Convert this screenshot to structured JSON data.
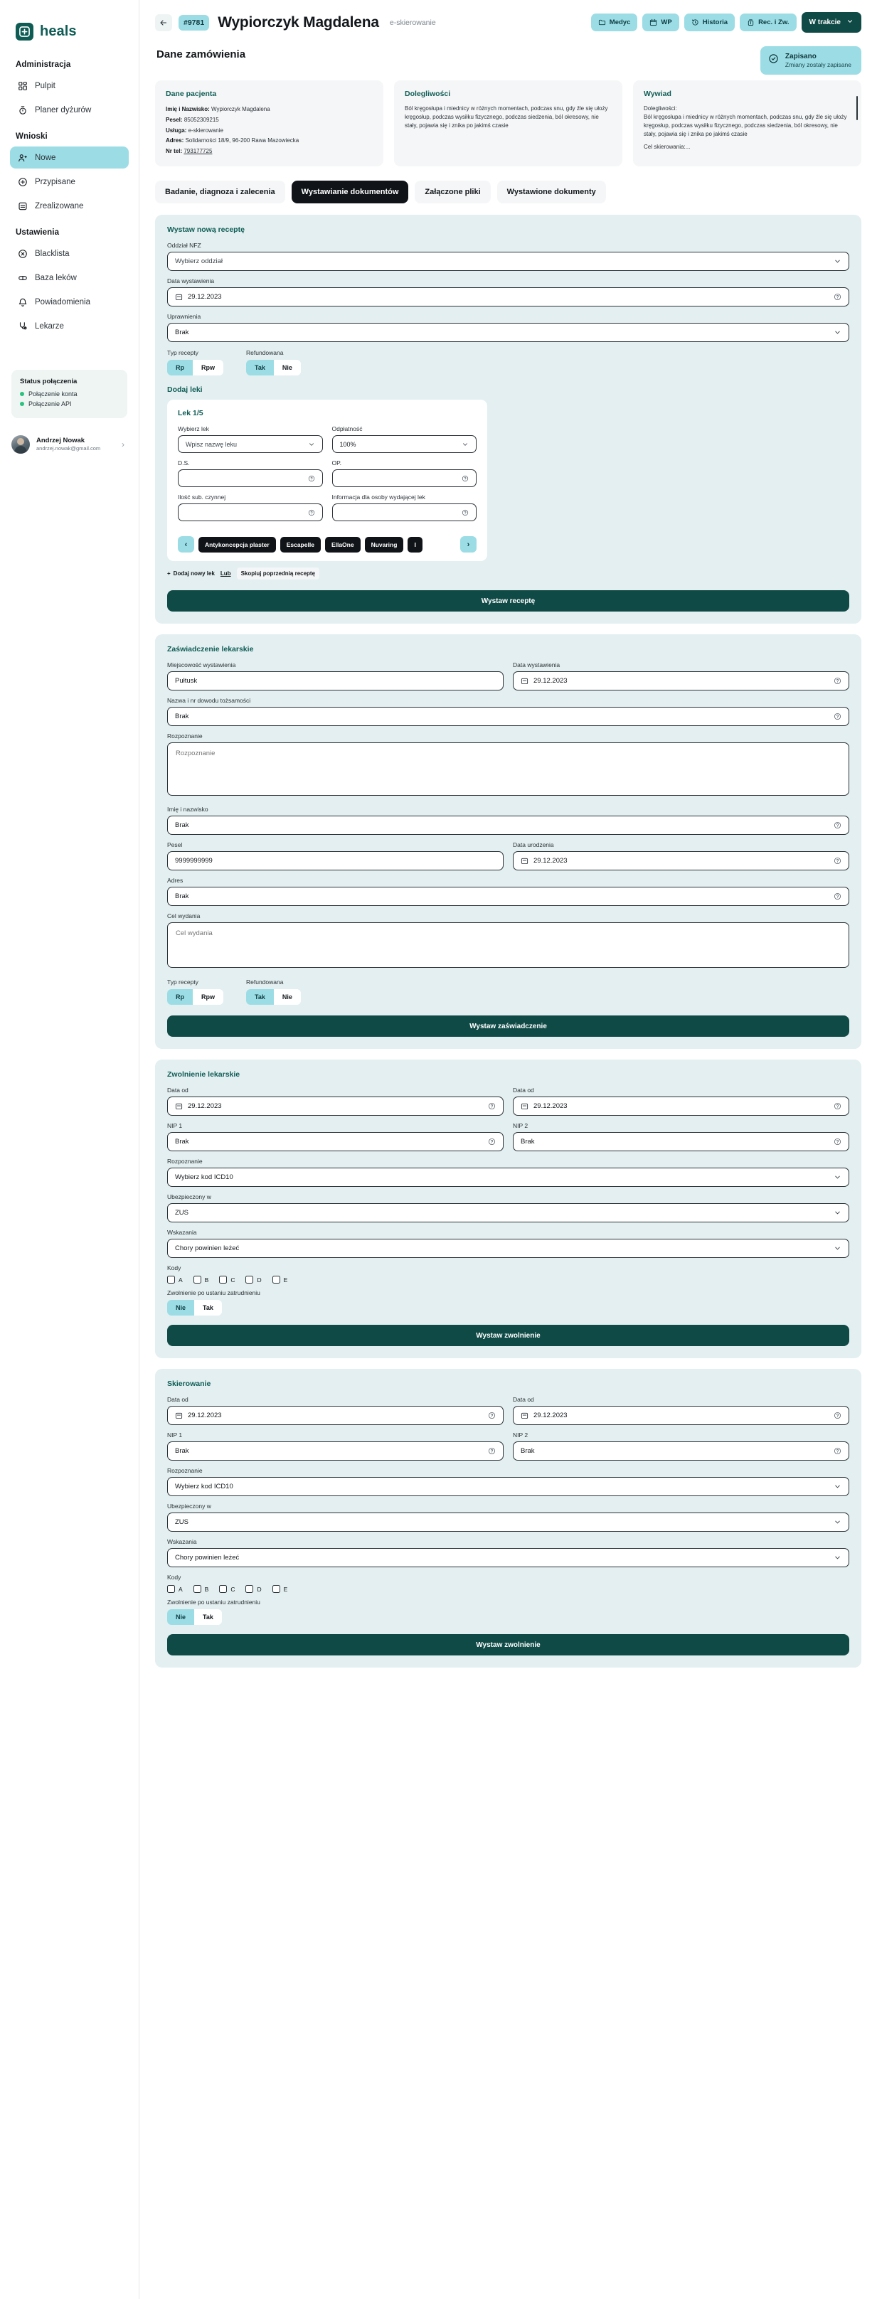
{
  "brand": {
    "name": "heals",
    "logo_icon": "heals-cross-logo"
  },
  "sidebar": {
    "groups": [
      {
        "title": "Administracja",
        "items": [
          {
            "label": "Pulpit",
            "icon": "dashboard-icon",
            "active": false
          },
          {
            "label": "Planer dyżurów",
            "icon": "clock-icon",
            "active": false
          }
        ]
      },
      {
        "title": "Wnioski",
        "items": [
          {
            "label": "Nowe",
            "icon": "users-icon",
            "active": true
          },
          {
            "label": "Przypisane",
            "icon": "plus-circle-icon",
            "active": false
          },
          {
            "label": "Zrealizowane",
            "icon": "file-check-icon",
            "active": false
          }
        ]
      },
      {
        "title": "Ustawienia",
        "items": [
          {
            "label": "Blacklista",
            "icon": "ban-icon",
            "active": false
          },
          {
            "label": "Baza leków",
            "icon": "pill-icon",
            "active": false
          },
          {
            "label": "Powiadomienia",
            "icon": "bell-icon",
            "active": false
          },
          {
            "label": "Lekarze",
            "icon": "stethoscope-icon",
            "active": false
          }
        ]
      }
    ],
    "status": {
      "title": "Status połączenia",
      "items": [
        "Połączenie konta",
        "Połączenie API"
      ],
      "dot_color": "#2bc27f"
    },
    "user": {
      "name": "Andrzej Nowak",
      "email": "andrzej.nowak@gmail.com"
    }
  },
  "topbar": {
    "back_icon": "arrow-back-icon",
    "order_id": "#9781",
    "patient_name": "Wypiorczyk Magdalena",
    "service_type": "e-skierowanie",
    "actions": [
      {
        "label": "Medyc",
        "icon": "folder-icon"
      },
      {
        "label": "WP",
        "icon": "calendar-icon"
      },
      {
        "label": "Historia",
        "icon": "history-icon"
      },
      {
        "label": "Rec. i Zw.",
        "icon": "prescription-icon"
      }
    ],
    "status_label": "W trakcie",
    "status_icon": "chevron-down-icon"
  },
  "toast": {
    "icon": "check-circle-icon",
    "title": "Zapisano",
    "subtitle": "Zmiany zostały zapisane"
  },
  "page": {
    "section_title": "Dane zamówienia"
  },
  "cards": {
    "patient": {
      "title": "Dane pacjenta",
      "rows": [
        {
          "key": "Imię i Nazwisko:",
          "value": "Wypiorczyk Magdalena",
          "link": false
        },
        {
          "key": "Pesel:",
          "value": "85052309215",
          "link": false
        },
        {
          "key": "Usługa:",
          "value": "e-skierowanie",
          "link": false
        },
        {
          "key": "Adres:",
          "value": "Solidarności 18/9, 96-200 Rawa Mazowiecka",
          "link": false
        },
        {
          "key": "Nr tel:",
          "value": "793177725",
          "link": true
        }
      ]
    },
    "ailments": {
      "title": "Dolegliwości",
      "text": "Ból kręgosłupa i miednicy w różnych momentach, podczas snu, gdy źle się ułoży kręgosłup, podczas wysiłku fizycznego, podczas siedzenia, ból okresowy, nie stały, pojawia się i znika po jakimś czasie"
    },
    "interview": {
      "title": "Wywiad",
      "label": "Dolegliwości:",
      "text": "Ból kręgosłupa i miednicy w różnych momentach, podczas snu, gdy źle się ułoży kręgosłup, podczas wysiłku fizycznego, podczas siedzenia, ból okresowy, nie stały, pojawia się i znika po jakimś czasie",
      "footer": "Cel skierowania:..."
    }
  },
  "tabs": [
    {
      "label": "Badanie, diagnoza i zalecenia",
      "active": false
    },
    {
      "label": "Wystawianie dokumentów",
      "active": true
    },
    {
      "label": "Załączone pliki",
      "active": false
    },
    {
      "label": "Wystawione dokumenty",
      "active": false
    }
  ],
  "prescription": {
    "panel_title": "Wystaw nową receptę",
    "nfz_label": "Oddział NFZ",
    "nfz_value": "Wybierz oddział",
    "issue_date_label": "Data wystawienia",
    "issue_date_value": "29.12.2023",
    "rights_label": "Uprawnienia",
    "rights_value": "Brak",
    "type_label": "Typ recepty",
    "type_options": [
      "Rp",
      "Rpw"
    ],
    "type_selected": "Rp",
    "refund_label": "Refundowana",
    "refund_options": [
      "Tak",
      "Nie"
    ],
    "refund_selected": "Tak",
    "add_drugs_label": "Dodaj leki",
    "drug": {
      "title": "Lek 1/5",
      "select_drug_label": "Wybierz lek",
      "select_drug_value": "Wpisz nazwę leku",
      "payment_label": "Odpłatność",
      "payment_value": "100%",
      "ds_label": "D.S.",
      "ds_value": "",
      "op_label": "OP.",
      "op_value": "",
      "substance_label": "Ilość sub. czynnej",
      "substance_value": "",
      "dispenser_label": "Informacja dla osoby wydającej lek",
      "dispenser_value": ""
    },
    "carousel_prev_icon": "chevron-left-icon",
    "carousel_next_icon": "chevron-right-icon",
    "drug_pills": [
      "Antykoncepcja plaster",
      "Escapelle",
      "EllaOne",
      "Nuvaring",
      "I"
    ],
    "add_new_drug": "Dodaj nowy lek",
    "or_label": "Lub",
    "copy_previous": "Skopiuj poprzednią receptę",
    "submit_label": "Wystaw receptę"
  },
  "certificate": {
    "panel_title": "Zaświadczenie lekarskie",
    "city_label": "Miejscowość wystawienia",
    "city_value": "Pułtusk",
    "date_label": "Data wystawienia",
    "date_value": "29.12.2023",
    "id_label": "Nazwa i nr dowodu tożsamości",
    "id_value": "Brak",
    "diagnosis_label": "Rozpoznanie",
    "diagnosis_placeholder": "Rozpoznanie",
    "name_label": "Imię i nazwisko",
    "name_value": "Brak",
    "pesel_label": "Pesel",
    "pesel_value": "9999999999",
    "birth_label": "Data urodzenia",
    "birth_value": "29.12.2023",
    "address_label": "Adres",
    "address_value": "Brak",
    "purpose_label": "Cel wydania",
    "purpose_placeholder": "Cel wydania",
    "type_label": "Typ recepty",
    "type_options": [
      "Rp",
      "Rpw"
    ],
    "type_selected": "Rp",
    "refund_label": "Refundowana",
    "refund_options": [
      "Tak",
      "Nie"
    ],
    "refund_selected": "Tak",
    "submit_label": "Wystaw zaświadczenie"
  },
  "sick_leave": {
    "panel_title": "Zwolnienie lekarskie",
    "date_from_label": "Data od",
    "date_from_value": "29.12.2023",
    "date_to_label": "Data od",
    "date_to_value": "29.12.2023",
    "nip1_label": "NIP 1",
    "nip1_value": "Brak",
    "nip2_label": "NIP 2",
    "nip2_value": "Brak",
    "diagnosis_label": "Rozpoznanie",
    "diagnosis_value": "Wybierz kod ICD10",
    "insured_label": "Ubezpieczony w",
    "insured_value": "ZUS",
    "indications_label": "Wskazania",
    "indications_value": "Chory powinien leżeć",
    "codes_label": "Kody",
    "codes": [
      "A",
      "B",
      "C",
      "D",
      "E"
    ],
    "after_employment_label": "Zwolnienie po ustaniu zatrudnieniu",
    "after_employment_options": [
      "Nie",
      "Tak"
    ],
    "after_employment_selected": "Nie",
    "submit_label": "Wystaw zwolnienie"
  },
  "referral": {
    "panel_title": "Skierowanie",
    "date_from_label": "Data od",
    "date_from_value": "29.12.2023",
    "date_to_label": "Data od",
    "date_to_value": "29.12.2023",
    "nip1_label": "NIP 1",
    "nip1_value": "Brak",
    "nip2_label": "NIP 2",
    "nip2_value": "Brak",
    "diagnosis_label": "Rozpoznanie",
    "diagnosis_value": "Wybierz kod ICD10",
    "insured_label": "Ubezpieczony w",
    "insured_value": "ZUS",
    "indications_label": "Wskazania",
    "indications_value": "Chory powinien leżeć",
    "codes_label": "Kody",
    "codes": [
      "A",
      "B",
      "C",
      "D",
      "E"
    ],
    "after_employment_label": "Zwolnienie po ustaniu zatrudnieniu",
    "after_employment_options": [
      "Nie",
      "Tak"
    ],
    "after_employment_selected": "Nie",
    "submit_label": "Wystaw zwolnienie"
  },
  "colors": {
    "brand_dark": "#0f5c55",
    "accent_cyan": "#9cdde5",
    "panel_bg": "#e3eff0",
    "submit_bg": "#0f4a46",
    "status_green": "#2bc27f"
  }
}
